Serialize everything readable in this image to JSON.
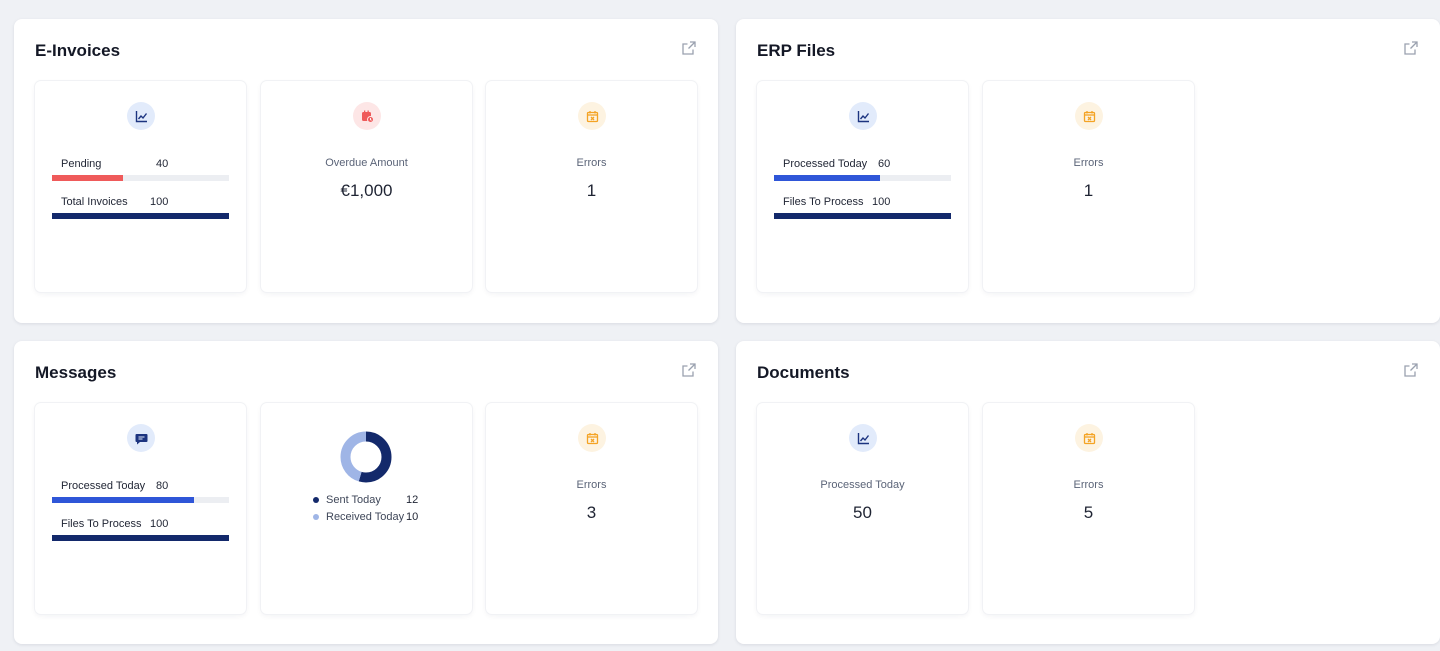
{
  "colors": {
    "accent_navy": "#13296b",
    "accent_blue": "#2f56d8",
    "pending_red": "#ef5a5a",
    "donut_light": "#9fb5e6",
    "icon_amber": "#f4a324"
  },
  "einvoices": {
    "title": "E-Invoices",
    "link_icon": "external-link-icon",
    "summary": {
      "icon": "chart-line-icon",
      "rows": [
        {
          "label": "Pending",
          "value": "40",
          "fill": 0.4,
          "color": "#ef5a5a"
        },
        {
          "label": "Total Invoices",
          "value": "100",
          "fill": 1.0,
          "color": "#13296b"
        }
      ]
    },
    "overdue": {
      "icon": "calendar-alert-icon",
      "label": "Overdue Amount",
      "value": "€1,000"
    },
    "errors": {
      "icon": "calendar-x-icon",
      "label": "Errors",
      "value": "1"
    }
  },
  "erp": {
    "title": "ERP Files",
    "link_icon": "external-link-icon",
    "summary": {
      "icon": "chart-line-icon",
      "rows": [
        {
          "label": "Processed Today",
          "value": "60",
          "fill": 0.6,
          "color": "#2f56d8"
        },
        {
          "label": "Files To Process",
          "value": "100",
          "fill": 1.0,
          "color": "#13296b"
        }
      ]
    },
    "errors": {
      "icon": "calendar-x-icon",
      "label": "Errors",
      "value": "1"
    }
  },
  "messages": {
    "title": "Messages",
    "link_icon": "external-link-icon",
    "summary": {
      "icon": "message-icon",
      "rows": [
        {
          "label": "Processed Today",
          "value": "80",
          "fill": 0.8,
          "color": "#2f56d8"
        },
        {
          "label": "Files To Process",
          "value": "100",
          "fill": 1.0,
          "color": "#13296b"
        }
      ]
    },
    "donut": {
      "sent_label": "Sent Today",
      "sent_value": "12",
      "received_label": "Received Today",
      "received_value": "10"
    },
    "errors": {
      "icon": "calendar-x-icon",
      "label": "Errors",
      "value": "3"
    }
  },
  "documents": {
    "title": "Documents",
    "link_icon": "external-link-icon",
    "processed": {
      "icon": "chart-line-icon",
      "label": "Processed Today",
      "value": "50"
    },
    "errors": {
      "icon": "calendar-x-icon",
      "label": "Errors",
      "value": "5"
    }
  },
  "chart_data": {
    "type": "pie",
    "donut": true,
    "categories": [
      "Sent Today",
      "Received Today"
    ],
    "values": [
      12,
      10
    ],
    "colors": [
      "#13296b",
      "#9fb5e6"
    ],
    "legend": "bottom"
  }
}
